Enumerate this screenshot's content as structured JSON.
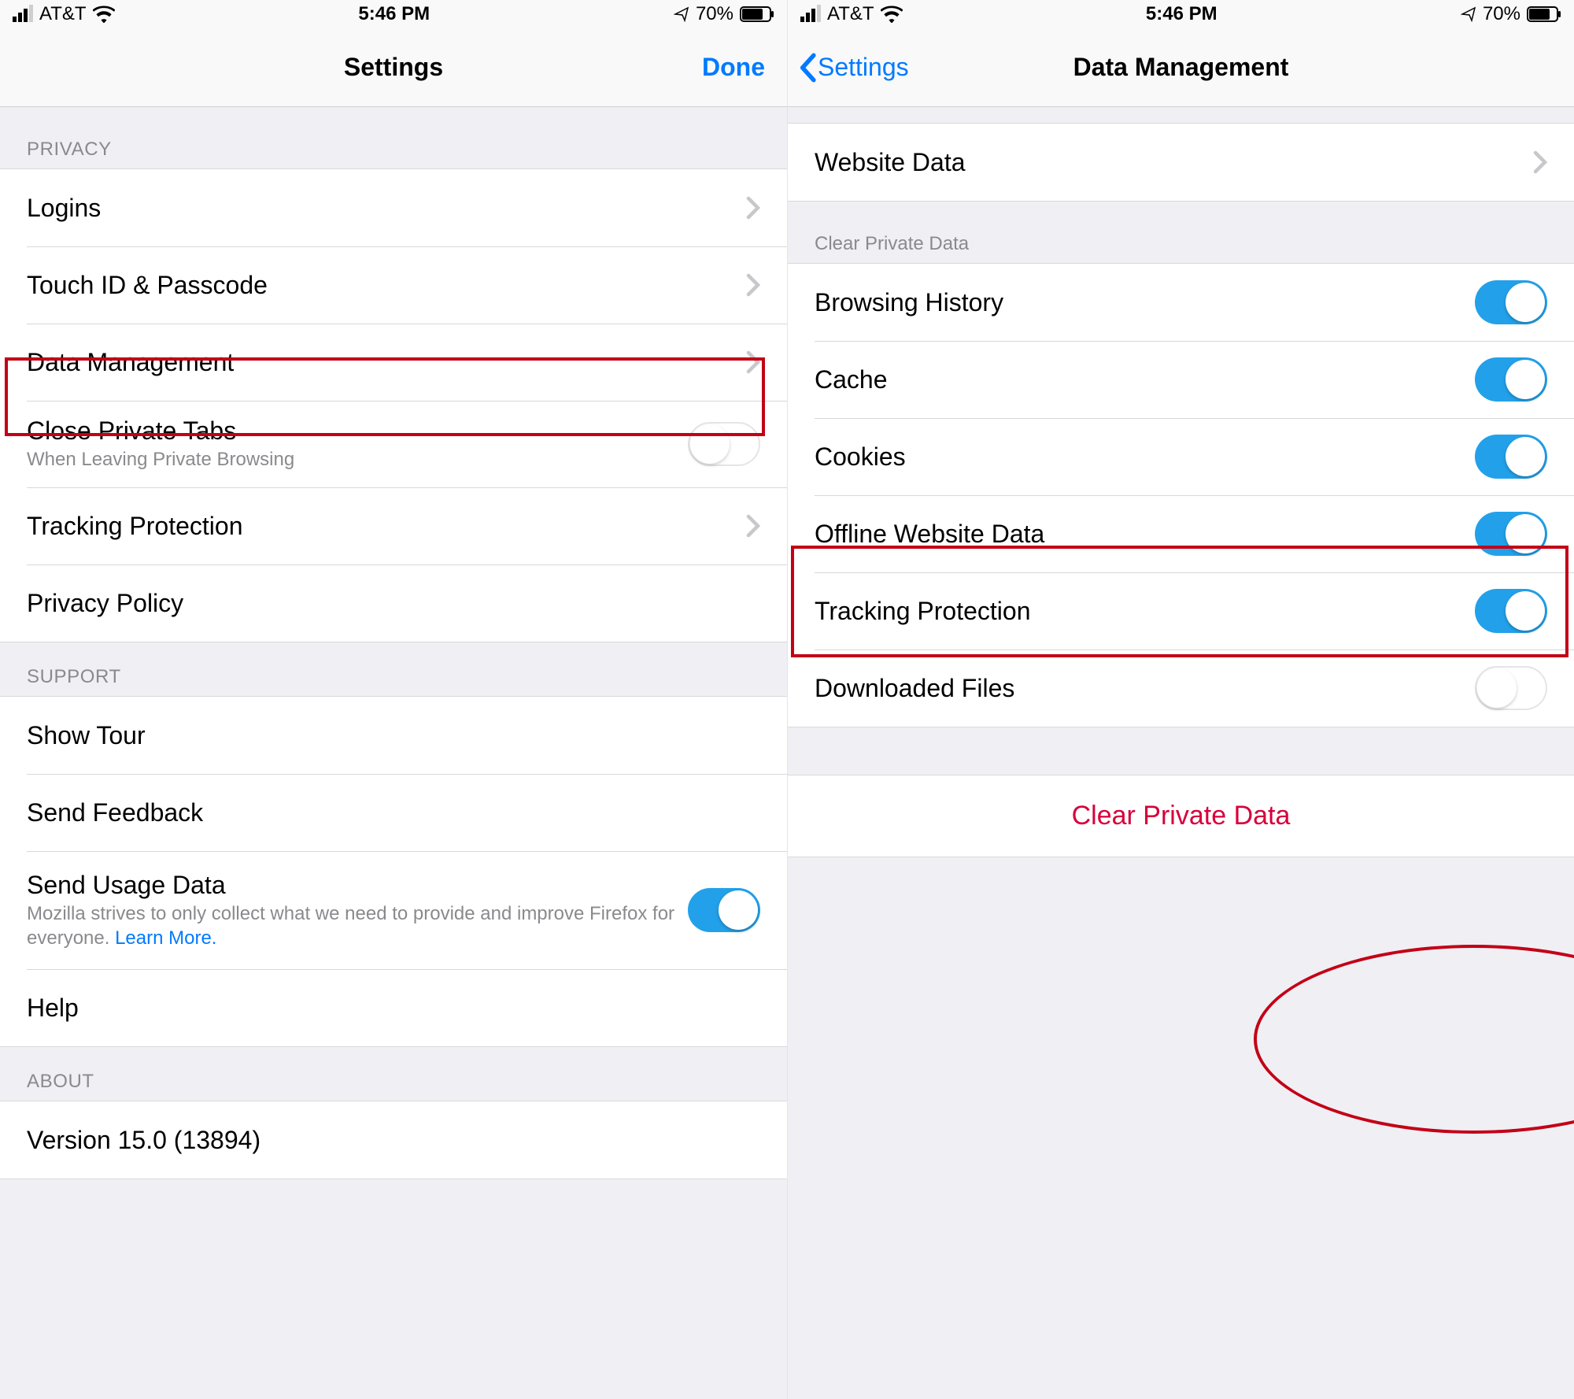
{
  "statusbar": {
    "carrier": "AT&T",
    "time": "5:46 PM",
    "battery_pct": "70%"
  },
  "left": {
    "title": "Settings",
    "done": "Done",
    "sections": {
      "privacy_header": "PRIVACY",
      "support_header": "SUPPORT",
      "about_header": "ABOUT"
    },
    "rows": {
      "logins": "Logins",
      "touchid": "Touch ID & Passcode",
      "data_mgmt": "Data Management",
      "close_private": "Close Private Tabs",
      "close_private_sub": "When Leaving Private Browsing",
      "tracking": "Tracking Protection",
      "privacy_policy": "Privacy Policy",
      "show_tour": "Show Tour",
      "send_feedback": "Send Feedback",
      "send_usage": "Send Usage Data",
      "send_usage_sub": "Mozilla strives to only collect what we need to provide and improve Firefox for everyone. ",
      "learn_more": "Learn More.",
      "help": "Help",
      "version": "Version 15.0 (13894)"
    }
  },
  "right": {
    "back": "Settings",
    "title": "Data Management",
    "website_data": "Website Data",
    "cpd_header": "Clear Private Data",
    "rows": {
      "history": "Browsing History",
      "cache": "Cache",
      "cookies": "Cookies",
      "offline": "Offline Website Data",
      "tracking": "Tracking Protection",
      "downloads": "Downloaded Files"
    },
    "clear_button": "Clear Private Data"
  }
}
